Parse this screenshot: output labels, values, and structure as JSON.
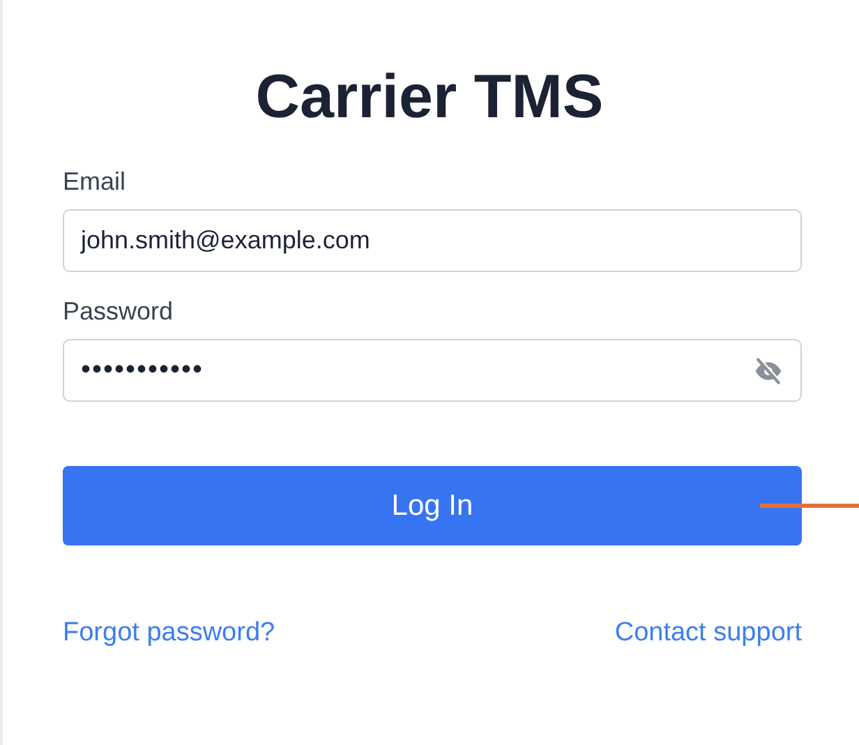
{
  "title": "Carrier TMS",
  "fields": [
    {
      "label": "Email",
      "value": "john.smith@example.com",
      "kind": "text"
    },
    {
      "label": "Password",
      "value": "•••••••••••",
      "kind": "password",
      "show_password": false
    }
  ],
  "login_button": "Log In",
  "links": [
    "Forgot password?",
    "Contact support"
  ]
}
